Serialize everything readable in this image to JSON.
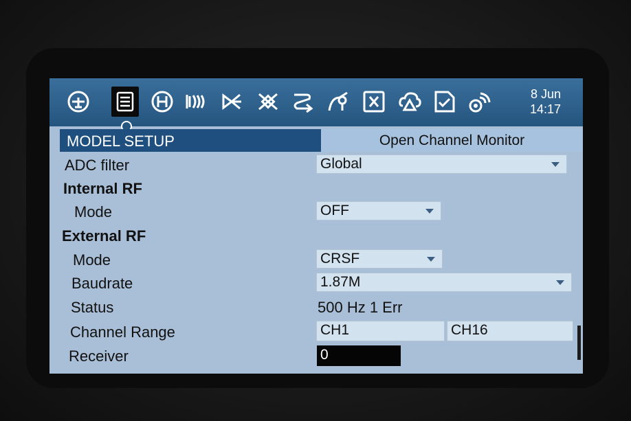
{
  "tabs": [
    {
      "icon": "radio-menu-icon"
    },
    {
      "icon": "model-setup-icon",
      "selected": true
    },
    {
      "icon": "heli-setup-icon"
    },
    {
      "icon": "flight-modes-icon"
    },
    {
      "icon": "inputs-icon"
    },
    {
      "icon": "mixer-icon"
    },
    {
      "icon": "outputs-icon"
    },
    {
      "icon": "curves-icon"
    },
    {
      "icon": "logical-switches-icon"
    },
    {
      "icon": "special-functions-icon"
    },
    {
      "icon": "checklist-icon"
    },
    {
      "icon": "telemetry-icon"
    }
  ],
  "datetime": {
    "date": "8 Jun",
    "time": "14:17"
  },
  "header": {
    "title": "MODEL SETUP",
    "monitor_button": "Open Channel Monitor"
  },
  "rows": {
    "adc_filter": {
      "label": "ADC filter",
      "value": "Global"
    },
    "internal_rf": {
      "label": "Internal RF"
    },
    "internal_mode": {
      "label": "Mode",
      "value": "OFF"
    },
    "external_rf": {
      "label": "External RF"
    },
    "external_mode": {
      "label": "Mode",
      "value": "CRSF"
    },
    "baudrate": {
      "label": "Baudrate",
      "value": "1.87M"
    },
    "status": {
      "label": "Status",
      "value": "500 Hz 1 Err"
    },
    "channel_range": {
      "label": "Channel Range",
      "start": "CH1",
      "end": "CH16"
    },
    "receiver": {
      "label": "Receiver",
      "value": "0"
    }
  },
  "colors": {
    "accent": "#24557f",
    "screen_bg": "#a9bfd7",
    "title_bg": "#1e4f7f"
  }
}
